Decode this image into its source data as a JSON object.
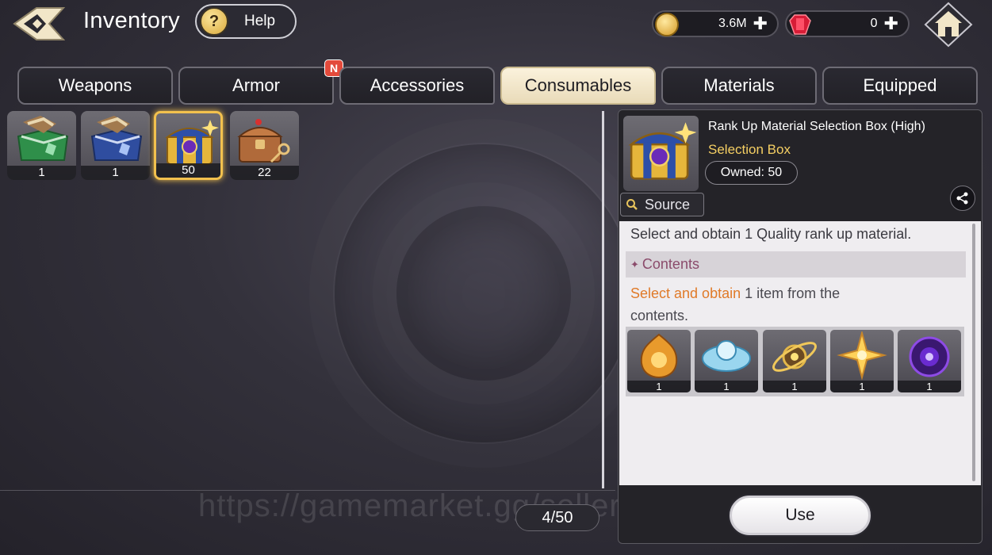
{
  "header": {
    "title": "Inventory",
    "help_label": "Help",
    "help_icon": "?",
    "gold": "3.6M",
    "gems": "0",
    "plus": "✚"
  },
  "tabs": [
    {
      "label": "Weapons",
      "active": false
    },
    {
      "label": "Armor",
      "active": false,
      "badge": "N"
    },
    {
      "label": "Accessories",
      "active": false
    },
    {
      "label": "Consumables",
      "active": true
    },
    {
      "label": "Materials",
      "active": false
    },
    {
      "label": "Equipped",
      "active": false
    }
  ],
  "items": [
    {
      "icon": "green-chest-icon",
      "qty": "1"
    },
    {
      "icon": "blue-chest-icon",
      "qty": "1"
    },
    {
      "icon": "gold-selection-box-icon",
      "qty": "50",
      "selected": true
    },
    {
      "icon": "bronze-chest-icon",
      "qty": "22"
    }
  ],
  "page_count": "4/50",
  "watermark": "https://gamemarket.gg/seller/GameN",
  "detail": {
    "name": "Rank Up Material Selection Box (High)",
    "type": "Selection Box",
    "owned": "Owned: 50",
    "source_label": "Source",
    "description": "Select and obtain 1 Quality rank up material.",
    "contents_label": "Contents",
    "select_highlight": "Select and obtain",
    "select_rest": " 1 item from the contents.",
    "rewards": [
      {
        "icon": "flame-emblem-icon",
        "qty": "1"
      },
      {
        "icon": "ice-crystal-icon",
        "qty": "1"
      },
      {
        "icon": "golden-orbit-icon",
        "qty": "1"
      },
      {
        "icon": "light-burst-icon",
        "qty": "1"
      },
      {
        "icon": "void-vortex-icon",
        "qty": "1"
      }
    ],
    "use_label": "Use"
  },
  "colors": {
    "accent_gold": "#f5cf63",
    "highlight_orange": "#e07a28",
    "contents_text": "#8b4b6b",
    "tab_active_bg": "#fbf2dc"
  }
}
